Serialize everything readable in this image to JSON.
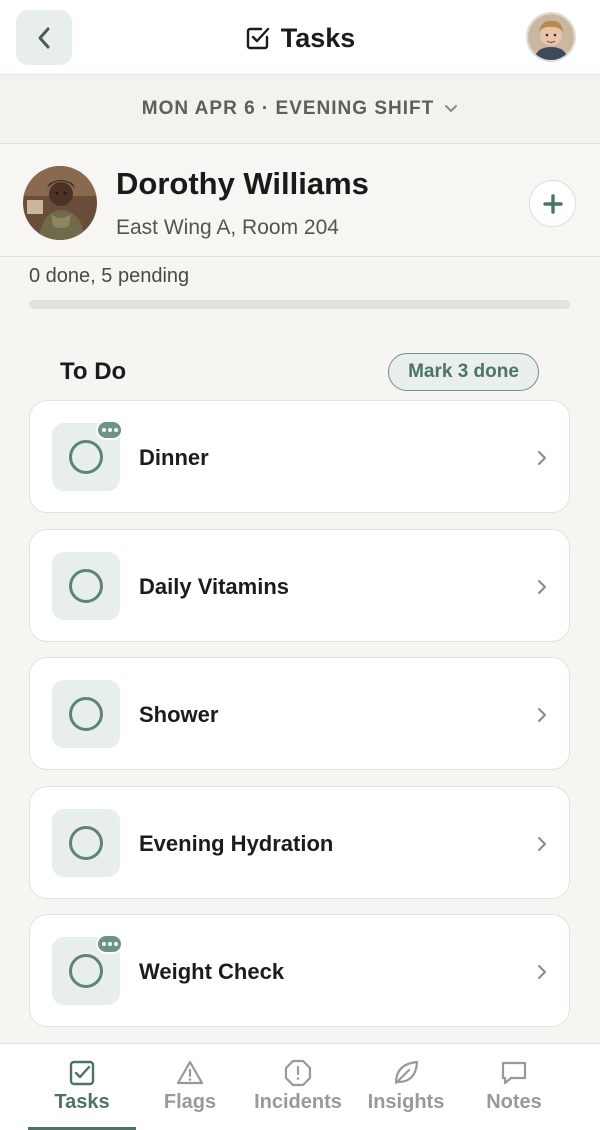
{
  "header": {
    "title": "Tasks",
    "back_icon": "chevron-left-icon",
    "title_icon": "checkbox-icon",
    "avatar": "user-avatar"
  },
  "shift": {
    "label": "MON APR 6 · EVENING SHIFT",
    "icon": "chevron-down-icon"
  },
  "resident": {
    "name": "Dorothy Williams",
    "room": "East Wing A, Room 204",
    "add_icon": "plus-icon"
  },
  "progress": {
    "text": "0 done, 5 pending",
    "done": 0,
    "total": 5
  },
  "section": {
    "title": "To Do",
    "mark_label": "Mark 3 done"
  },
  "tasks": [
    {
      "label": "Dinner",
      "has_note": true
    },
    {
      "label": "Daily Vitamins",
      "has_note": false
    },
    {
      "label": "Shower",
      "has_note": false
    },
    {
      "label": "Evening Hydration",
      "has_note": false
    },
    {
      "label": "Weight Check",
      "has_note": true
    }
  ],
  "nav": {
    "items": [
      {
        "label": "Tasks",
        "icon": "checkbox-icon",
        "active": true
      },
      {
        "label": "Flags",
        "icon": "warning-triangle-icon",
        "active": false
      },
      {
        "label": "Incidents",
        "icon": "alert-octagon-icon",
        "active": false
      },
      {
        "label": "Insights",
        "icon": "leaf-icon",
        "active": false
      },
      {
        "label": "Notes",
        "icon": "chat-bubble-icon",
        "active": false
      }
    ]
  },
  "colors": {
    "accent": "#4b7563",
    "accent_soft": "#e8eeea",
    "background": "#f6f5f2"
  }
}
